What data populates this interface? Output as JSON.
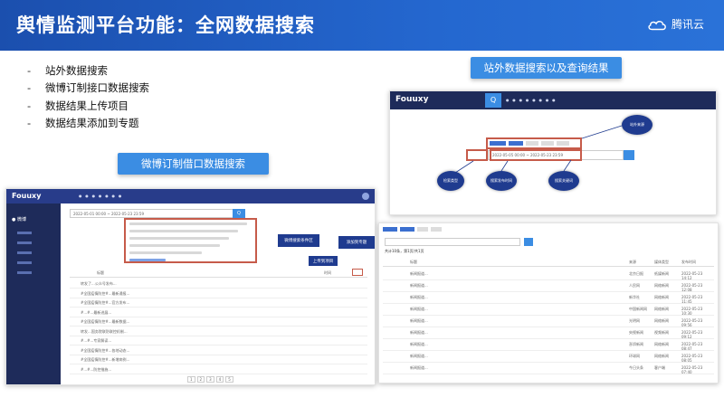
{
  "header": {
    "title": "舆情监测平台功能：全网数据搜索",
    "logo_text": "腾讯云"
  },
  "bullets": [
    "站外数据搜索",
    "微博订制接口数据搜索",
    "数据结果上传项目",
    "数据结果添加到专题"
  ],
  "pill_weibo": "微博订制借口数据搜索",
  "pill_external": "站外数据搜索以及查询结果",
  "shot_left": {
    "brand": "Fouuxy",
    "sidebar_item": "微博",
    "date_range": "2022-05-01 00:00 ~ 2022-05-23 23:59",
    "search_btn": "Q",
    "col_title": "标题",
    "col_time": "时间",
    "tag_filter": "微博搜索条件区",
    "tag_add_topic": "添加到专题",
    "tag_upload": "上传到项目",
    "pager": [
      "1",
      "2",
      "3",
      "4",
      "5"
    ],
    "rows": [
      "转发了...公众号发布...",
      "#全国疫情防控#...最新通报...",
      "#全国疫情防控#...官方发布...",
      "#...#...最新进展...",
      "#全国疫情防控#...最新数据...",
      "转发...国务院联防联控机制...",
      "#...#...专家解读...",
      "#全国疫情防控#...各地动态...",
      "#全国疫情防控#...新增病例...",
      "#...#...防控措施..."
    ]
  },
  "shot_right_top": {
    "brand": "Fouuxy",
    "search_icon": "Q",
    "bubble_source": "站外来源",
    "bubble_type": "检索类型",
    "bubble_time": "搜索发布时间",
    "bubble_keyword": "搜索关键词",
    "date_range": "2022-05-05 00:00 ~ 2022-05-23 23:59"
  },
  "shot_right_bottom": {
    "col_title": "标题",
    "col_source": "来源",
    "col_media": "媒体类型",
    "col_time": "发布时间",
    "rows_count_text": "共计10条，第1页/共1页",
    "rows": [
      [
        "新闻报道...",
        "北京日报",
        "纸媒新闻",
        "2022-05-23 14:12"
      ],
      [
        "新闻报道...",
        "人民网",
        "网络新闻",
        "2022-05-23 12:08"
      ],
      [
        "新闻报道...",
        "新华社",
        "网络新闻",
        "2022-05-23 11:45"
      ],
      [
        "新闻报道...",
        "中国新闻网",
        "网络新闻",
        "2022-05-23 10:30"
      ],
      [
        "新闻报道...",
        "光明网",
        "网络新闻",
        "2022-05-23 09:56"
      ],
      [
        "新闻报道...",
        "央视新闻",
        "视频新闻",
        "2022-05-23 09:12"
      ],
      [
        "新闻报道...",
        "澎湃新闻",
        "网络新闻",
        "2022-05-23 08:47"
      ],
      [
        "新闻报道...",
        "环球网",
        "网络新闻",
        "2022-05-23 08:05"
      ],
      [
        "新闻报道...",
        "今日头条",
        "客户端",
        "2022-05-23 07:40"
      ]
    ]
  }
}
